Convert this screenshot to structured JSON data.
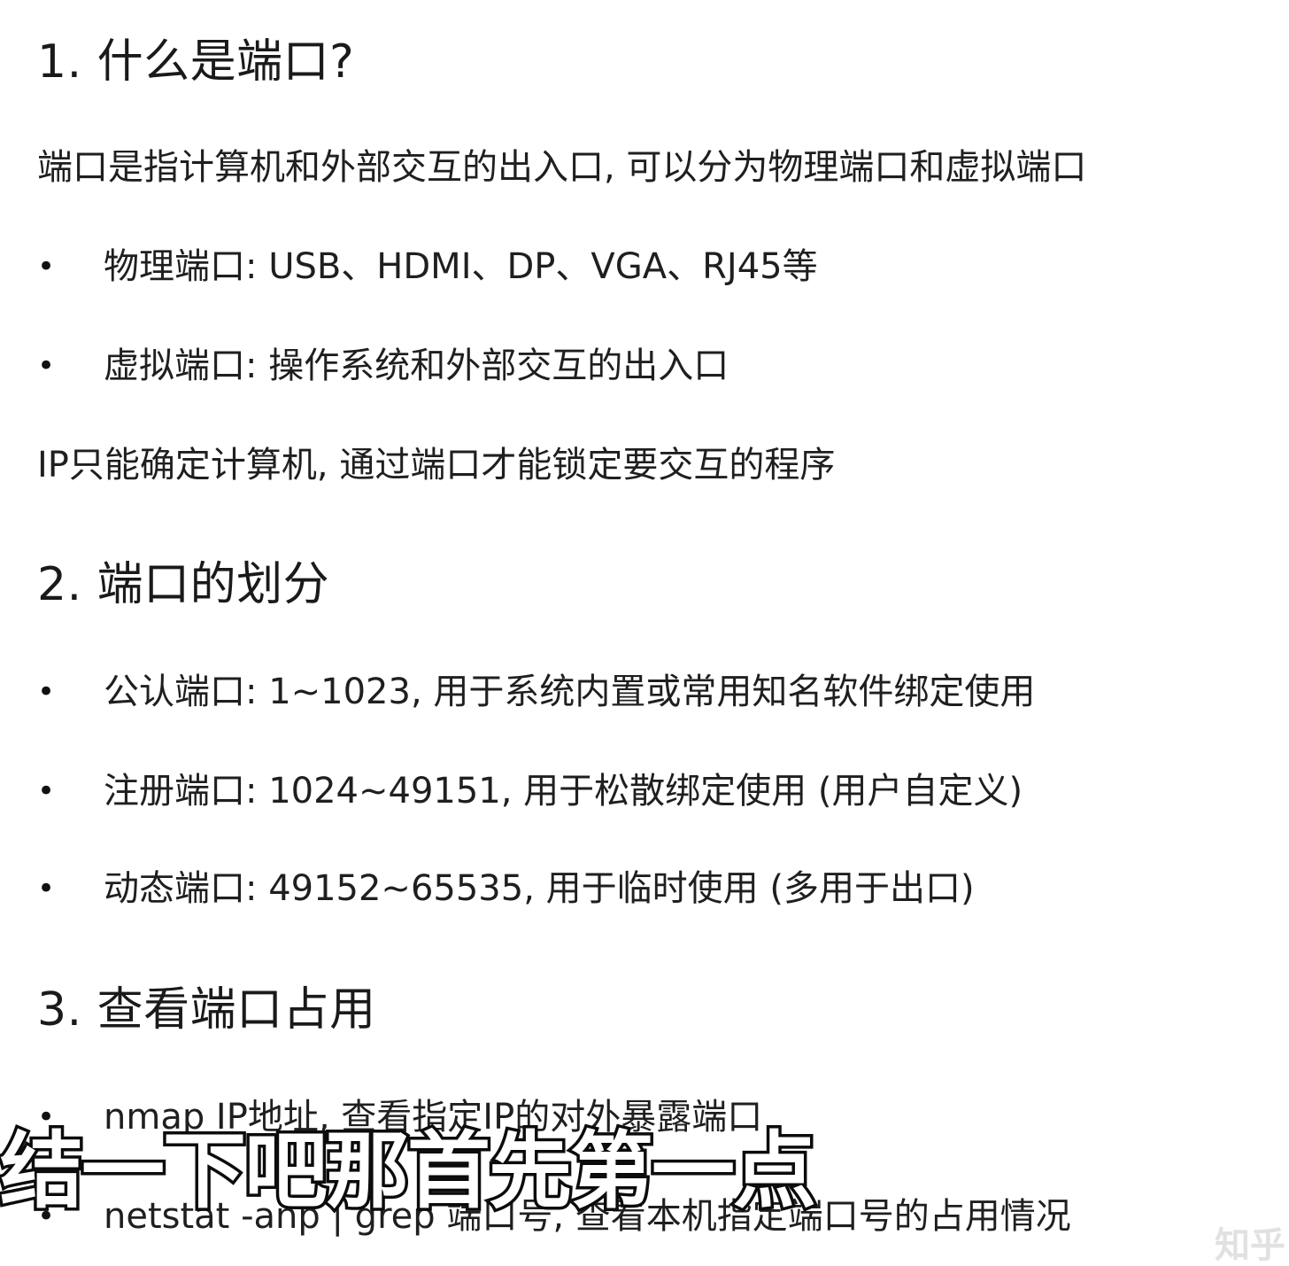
{
  "sections": [
    {
      "heading": "1. 什么是端口?",
      "paragraph": "端口是指计算机和外部交互的出入口, 可以分为物理端口和虚拟端口",
      "bullets": [
        "物理端口: USB、HDMI、DP、VGA、RJ45等",
        "虚拟端口: 操作系统和外部交互的出入口"
      ],
      "footer": "IP只能确定计算机, 通过端口才能锁定要交互的程序"
    },
    {
      "heading": "2. 端口的划分",
      "bullets": [
        "公认端口: 1~1023, 用于系统内置或常用知名软件绑定使用",
        "注册端口: 1024~49151, 用于松散绑定使用 (用户自定义)",
        "动态端口: 49152~65535, 用于临时使用 (多用于出口)"
      ]
    },
    {
      "heading": "3. 查看端口占用",
      "bullets": [
        "nmap IP地址, 查看指定IP的对外暴露端口",
        "netstat -anp | grep 端口号, 查看本机指定端口号的占用情况"
      ]
    }
  ],
  "bullet_symbol": "•",
  "subtitle_overlay": "结一下吧那首先第一点",
  "watermark": "知乎"
}
